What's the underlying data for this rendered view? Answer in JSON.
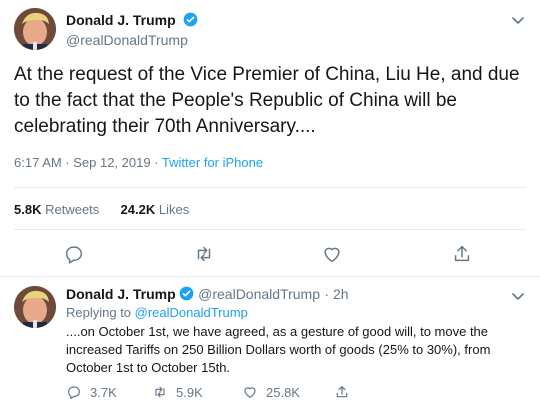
{
  "main_tweet": {
    "author_name": "Donald J. Trump",
    "author_handle": "@realDonaldTrump",
    "text": "At the request of the Vice Premier of China, Liu He, and due to the fact that the People's Republic of China will be celebrating their 70th Anniversary....",
    "time": "6:17 AM · Sep 12, 2019 · ",
    "source": "Twitter for iPhone",
    "retweets_count": "5.8K",
    "retweets_label": "Retweets",
    "likes_count": "24.2K",
    "likes_label": "Likes"
  },
  "reply_tweet": {
    "author_name": "Donald J. Trump",
    "author_handle": "@realDonaldTrump",
    "age": "· 2h",
    "replying_prefix": "Replying to ",
    "replying_to": "@realDonaldTrump",
    "text": "....on October 1st, we have agreed, as a gesture of good will, to move the increased Tariffs on 250 Billion Dollars worth of goods (25% to 30%), from October 1st to October 15th.",
    "reply_count": "3.7K",
    "retweet_count": "5.9K",
    "like_count": "25.8K"
  },
  "icons": {
    "verified": "verified-badge-icon",
    "more": "chevron-down-icon",
    "reply": "reply-icon",
    "retweet": "retweet-icon",
    "like": "heart-icon",
    "share": "share-icon"
  },
  "colors": {
    "accent": "#1da1f2",
    "muted": "#657786",
    "text": "#14171a",
    "divider": "#e6ecf0"
  }
}
